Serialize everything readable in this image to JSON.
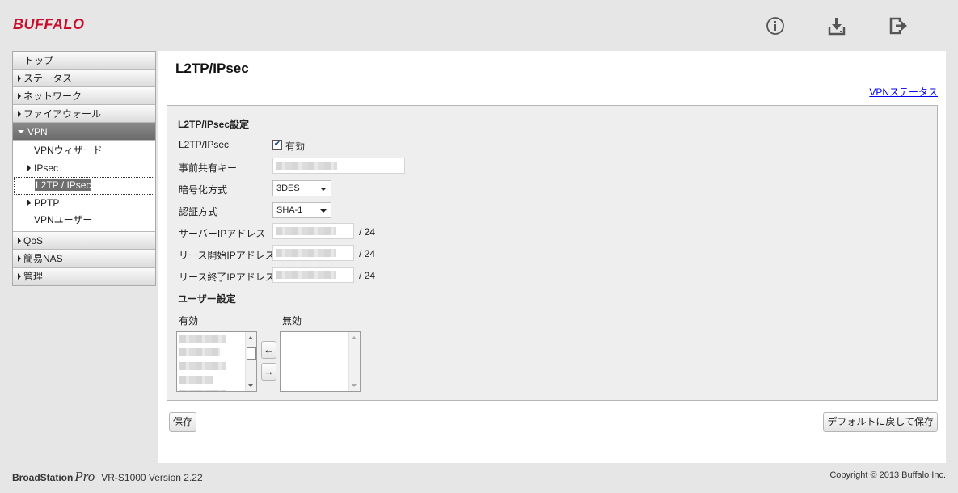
{
  "header": {
    "logo": "BUFFALO",
    "icons": [
      "info-icon",
      "download-icon",
      "logout-icon"
    ]
  },
  "sidebar": {
    "items": [
      {
        "label": "トップ"
      },
      {
        "label": "ステータス"
      },
      {
        "label": "ネットワーク"
      },
      {
        "label": "ファイアウォール"
      },
      {
        "label": "VPN"
      },
      {
        "label": "QoS"
      },
      {
        "label": "簡易NAS"
      },
      {
        "label": "管理"
      }
    ],
    "vpn_sub": [
      {
        "label": "VPNウィザード"
      },
      {
        "label": "IPsec"
      },
      {
        "label": "L2TP / IPsec"
      },
      {
        "label": "PPTP"
      },
      {
        "label": "VPNユーザー"
      }
    ]
  },
  "main": {
    "title": "L2TP/IPsec",
    "vpn_status_link": "VPNステータス",
    "section_title": "L2TP/IPsec設定",
    "fields": {
      "l2tp_label": "L2TP/IPsec",
      "l2tp_checkbox_label": "有効",
      "l2tp_checked": true,
      "psk_label": "事前共有キー",
      "encryption_label": "暗号化方式",
      "encryption_value": "3DES",
      "auth_label": "認証方式",
      "auth_value": "SHA-1",
      "server_ip_label": "サーバーIPアドレス",
      "lease_start_label": "リース開始IPアドレス",
      "lease_end_label": "リース終了IPアドレス",
      "prefix": "/ 24"
    },
    "user_settings": {
      "title": "ユーザー設定",
      "enabled_label": "有効",
      "disabled_label": "無効",
      "move_left": "←",
      "move_right": "→"
    },
    "buttons": {
      "save": "保存",
      "reset_save": "デフォルトに戻して保存"
    }
  },
  "footer": {
    "brand_bs": "BroadStation",
    "brand_pro": "Pro",
    "model_version": "VR-S1000 Version 2.22",
    "copyright": "Copyright © 2013 Buffalo Inc."
  },
  "colors": {
    "brand_red": "#c8102e",
    "link_blue": "#0000ee",
    "active_nav": "#7a7a7a"
  }
}
